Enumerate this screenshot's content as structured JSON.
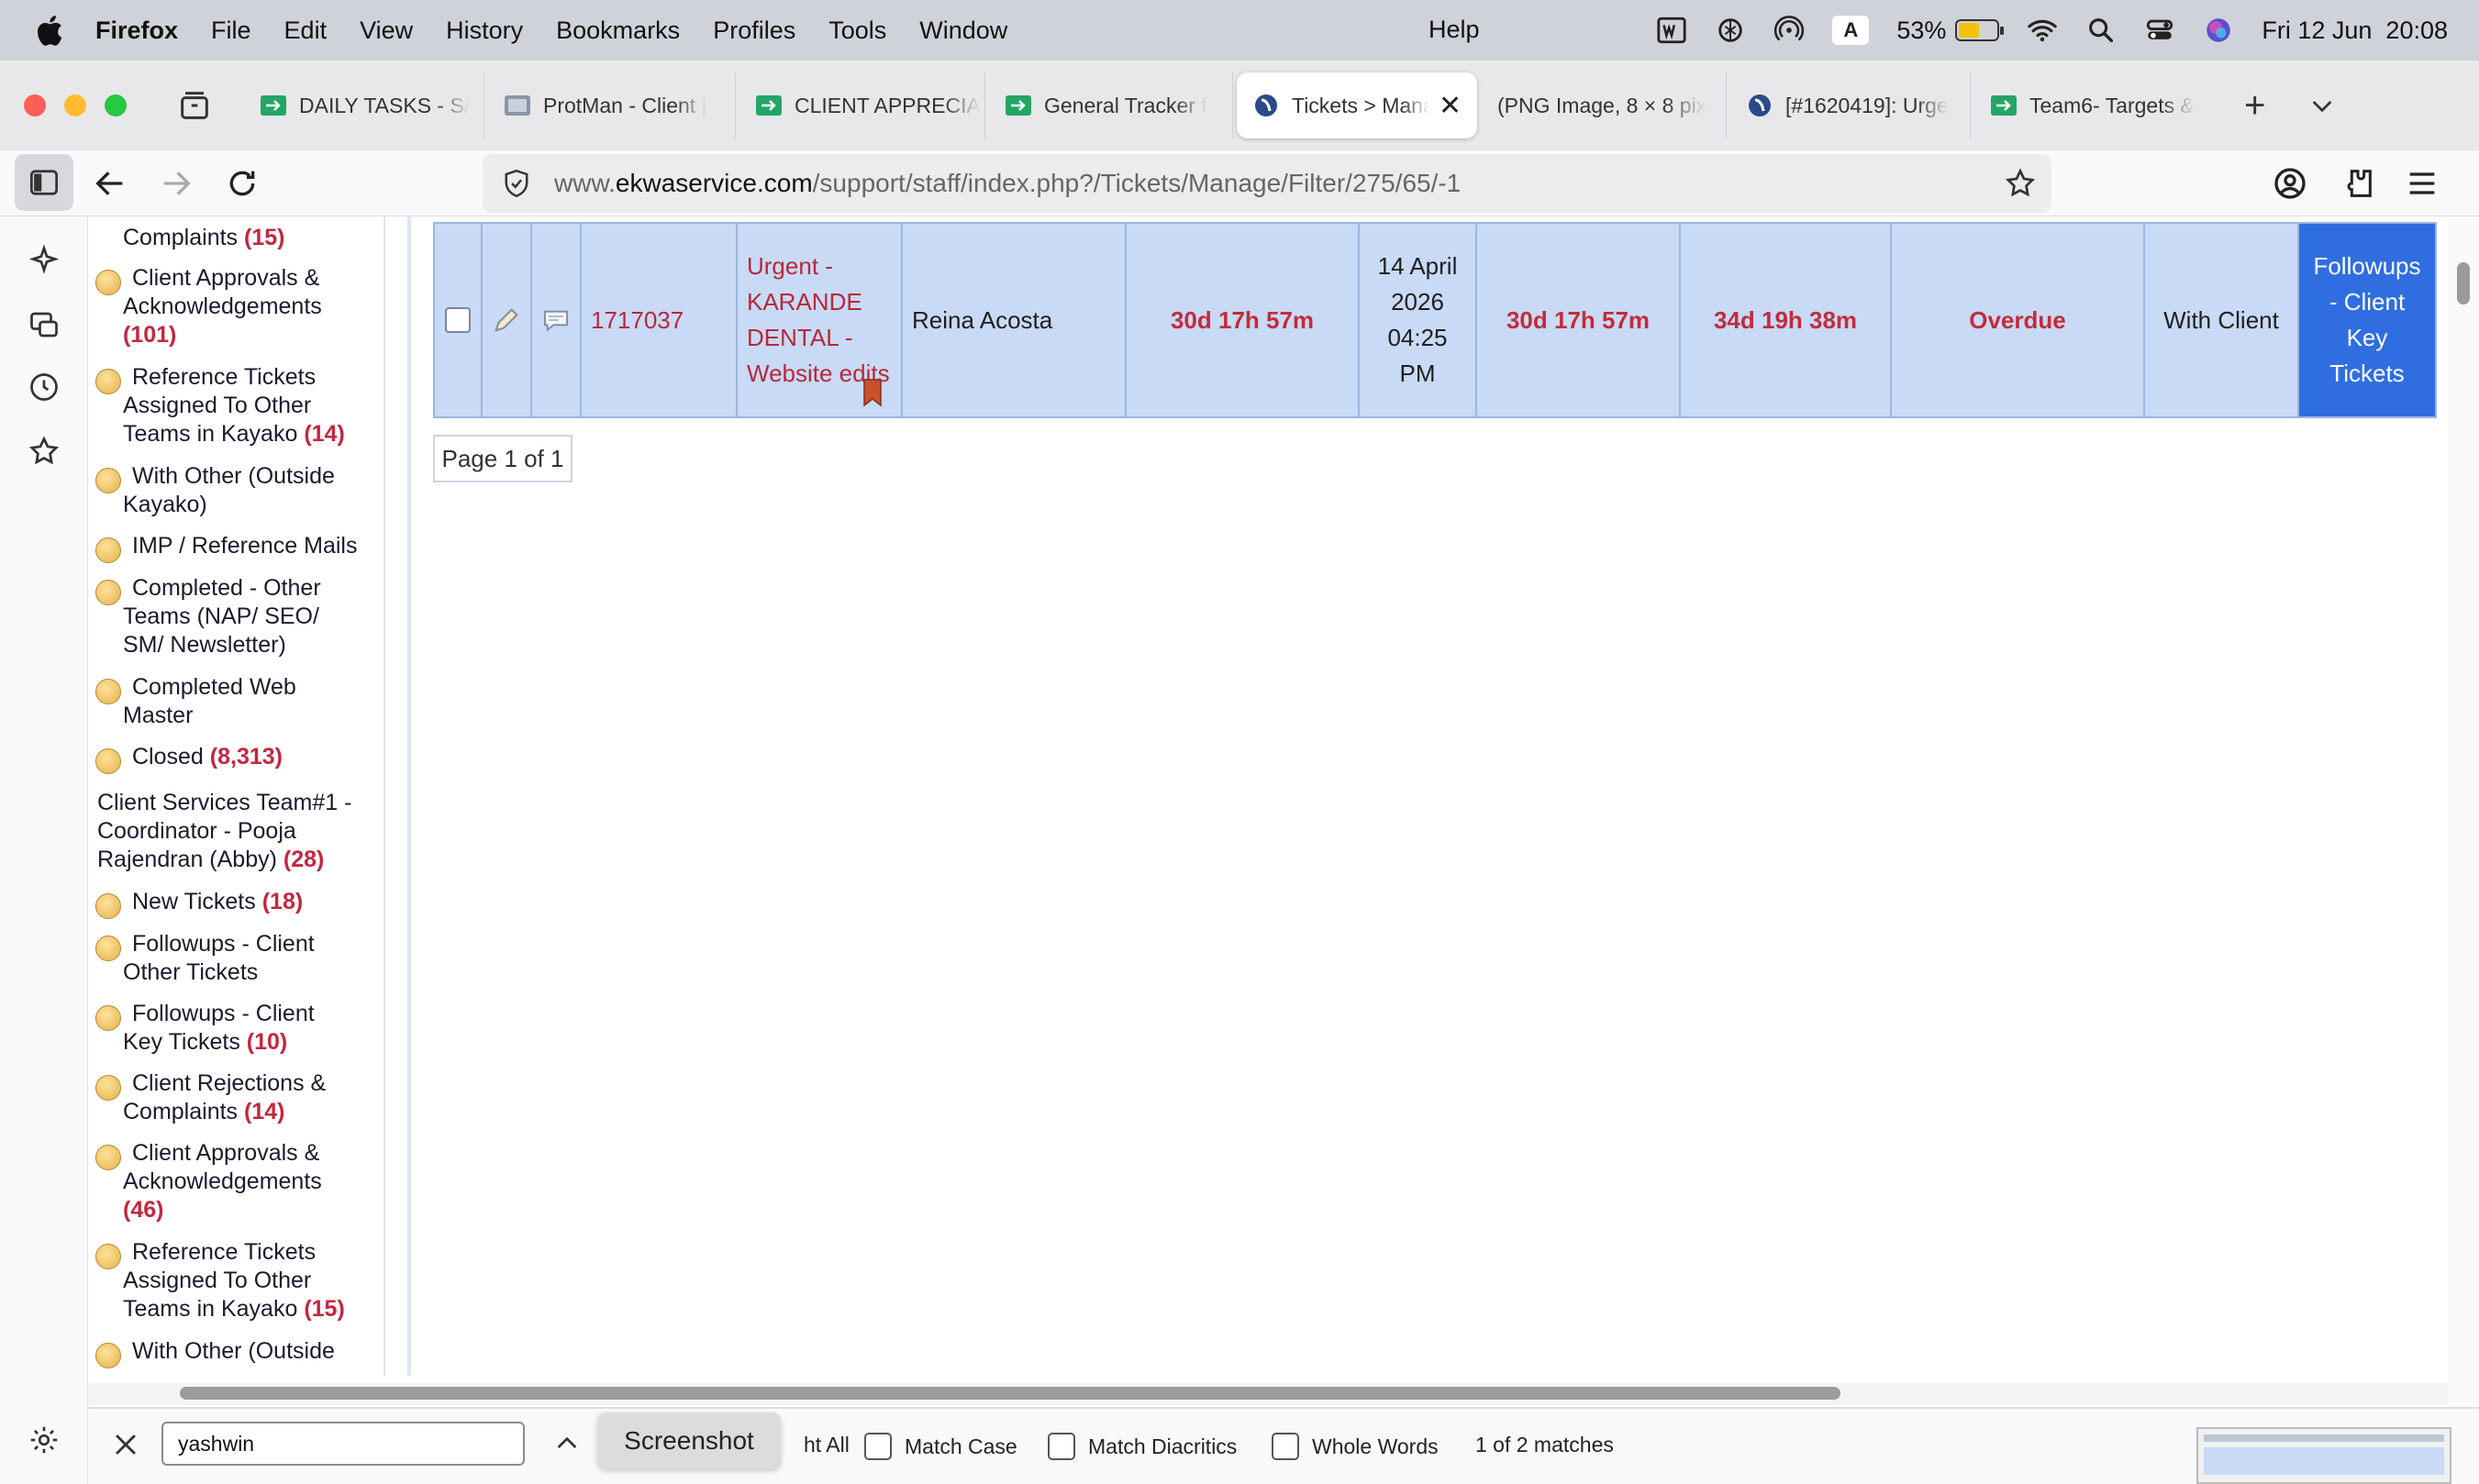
{
  "menubar": {
    "app": "Firefox",
    "items": [
      "File",
      "Edit",
      "View",
      "History",
      "Bookmarks",
      "Profiles",
      "Tools",
      "Window"
    ],
    "help": "Help",
    "battery_pct": "53%",
    "battery_level": 0.53,
    "input_source": "A",
    "datetime": "Fri 12 Jun  20:08"
  },
  "tabs": [
    {
      "label": "DAILY TASKS - S/",
      "icon": "sheets-icon"
    },
    {
      "label": "ProtMan - Client |",
      "icon": "protman-icon"
    },
    {
      "label": "CLIENT APPRECIA",
      "icon": "sheets-icon"
    },
    {
      "label": "General Tracker f",
      "icon": "sheets-icon"
    },
    {
      "label": "Tickets > Mana",
      "icon": "kayako-icon",
      "active": true
    },
    {
      "label": "(PNG Image, 8 × 8 pix",
      "icon": ""
    },
    {
      "label": "[#1620419]: Urge",
      "icon": "kayako-icon"
    },
    {
      "label": "Team6- Targets &",
      "icon": "sheets-icon"
    }
  ],
  "url": {
    "prefix": "www.",
    "domain": "ekwaservice.com",
    "path": "/support/staff/index.php?/Tickets/Manage/Filter/275/65/-1"
  },
  "left_panel": {
    "top_partial": {
      "label": "Complaints",
      "count": "(15)"
    },
    "items_a": [
      {
        "line1": "Client Approvals &",
        "line2": "Acknowledgements",
        "line3": "(101)"
      },
      {
        "line1": "Reference Tickets",
        "line2": "Assigned To Other",
        "line3": "Teams in Kayako",
        "count": "(14)"
      },
      {
        "line1": "With Other (Outside",
        "line2": "Kayako)"
      },
      {
        "line1": "IMP / Reference Mails"
      },
      {
        "line1": "Completed - Other",
        "line2": "Teams (NAP/ SEO/",
        "line3": "SM/ Newsletter)"
      },
      {
        "line1": "Completed Web",
        "line2": "Master"
      },
      {
        "line1": "Closed",
        "count": "(8,313)"
      }
    ],
    "group": {
      "line1": "Client Services Team#1 -",
      "line2": "Coordinator - Pooja",
      "line3": "Rajendran (Abby)",
      "count": "(28)"
    },
    "items_b": [
      {
        "line1": "New Tickets",
        "count": "(18)"
      },
      {
        "line1": "Followups - Client",
        "line2": "Other Tickets"
      },
      {
        "line1": "Followups - Client",
        "line2": "Key Tickets",
        "count": "(10)"
      },
      {
        "line1": "Client Rejections &",
        "line2": "Complaints",
        "count": "(14)"
      },
      {
        "line1": "Client Approvals &",
        "line2": "Acknowledgements",
        "line3": "(46)"
      },
      {
        "line1": "Reference Tickets",
        "line2": "Assigned To Other",
        "line3": "Teams in Kayako",
        "count": "(15)"
      },
      {
        "line1": "With Other (Outside"
      }
    ]
  },
  "ticket": {
    "id": "1717037",
    "subject_lines": [
      "Urgent -",
      "KARANDE",
      "DENTAL -",
      "Website edits"
    ],
    "owner": "Reina Acosta",
    "time1": "30d 17h 57m",
    "date_lines": [
      "14 April",
      "2026",
      "04:25",
      "PM"
    ],
    "time2": "30d 17h 57m",
    "time3": "34d 19h 38m",
    "due": "Overdue",
    "status": "With Client",
    "queue_lines": [
      "Followups",
      "- Client",
      "Key",
      "Tickets"
    ]
  },
  "pager": "Page 1 of 1",
  "findbar": {
    "query": "yashwin",
    "highlight_all": "ht All",
    "match_case": "Match Case",
    "match_diacritics": "Match Diacritics",
    "whole_words": "Whole Words",
    "result": "1 of 2 matches",
    "tooltip": "Screenshot"
  },
  "colors": {
    "row_bg": "#c8daf5",
    "queue_cell": "#2f6ee0",
    "count_red": "#c4263f"
  }
}
